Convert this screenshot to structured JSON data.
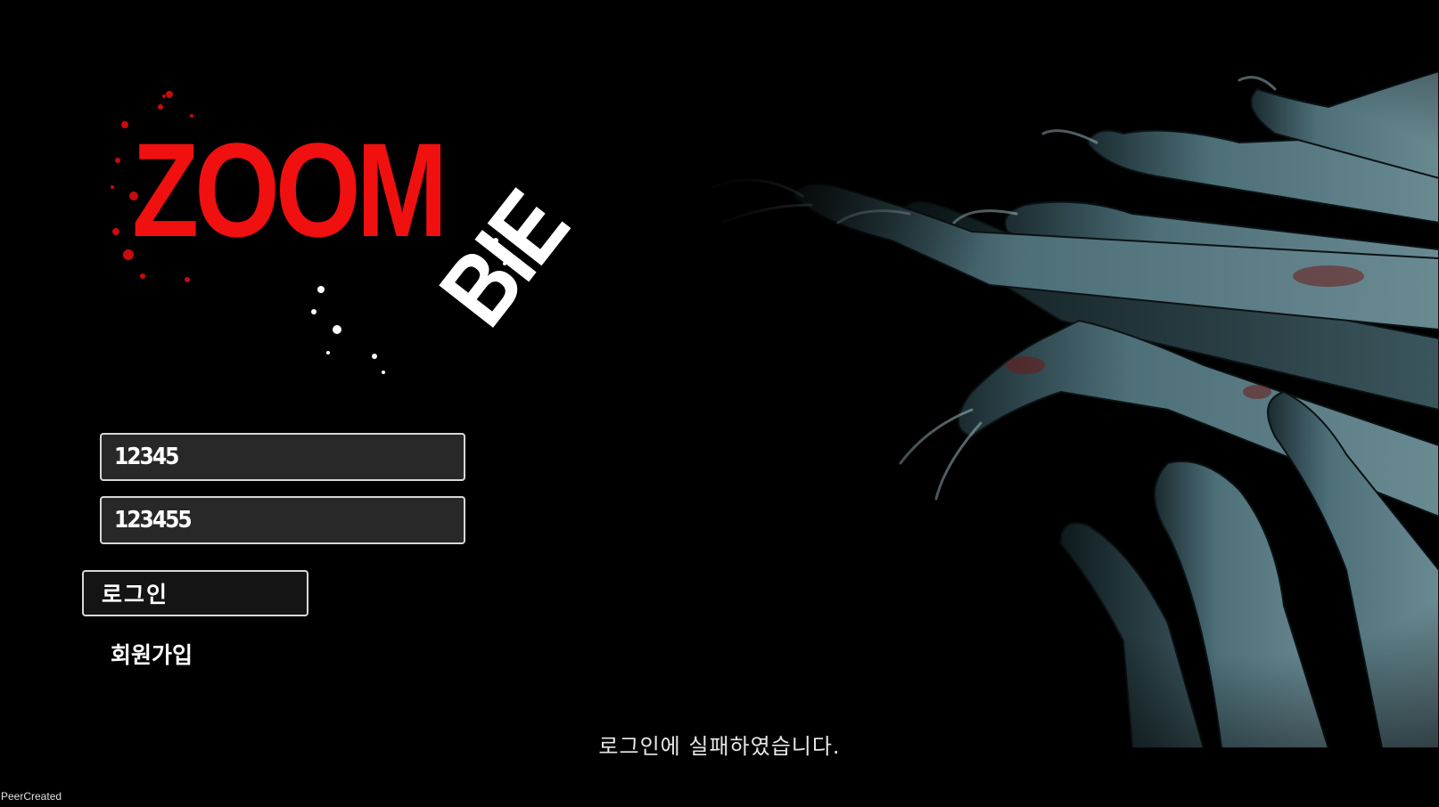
{
  "logo": {
    "word_main": "ZOOM",
    "word_sub": "BIE",
    "main_color": "#f01010",
    "sub_color": "#ffffff"
  },
  "background": {
    "image_icon": "zombie-hands-illustration",
    "tint": "#4a6a74"
  },
  "login_form": {
    "id_value": "12345",
    "password_value": "123455",
    "login_button_label": "로그인",
    "signup_link_label": "회원가입"
  },
  "status": {
    "message": "로그인에 실패하였습니다."
  },
  "footer": {
    "label": "PeerCreated"
  }
}
